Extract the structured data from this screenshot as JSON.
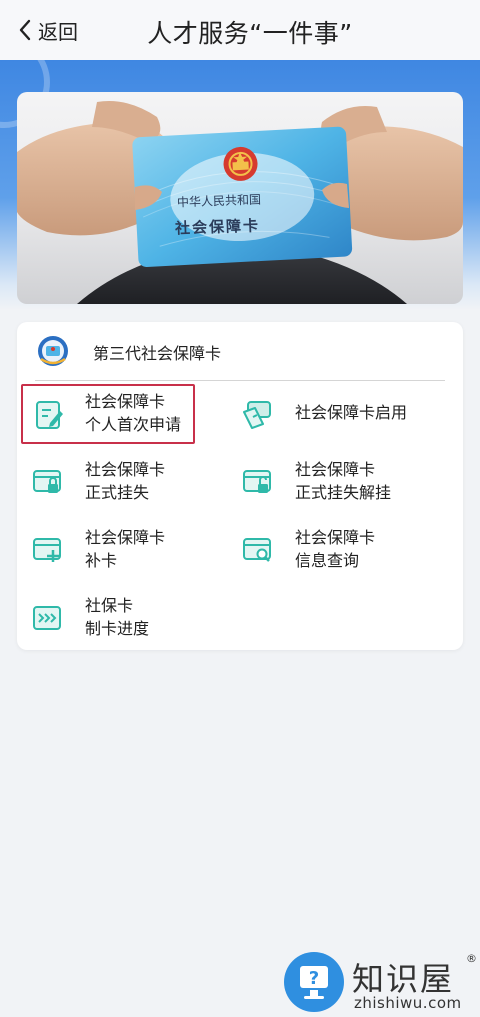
{
  "header": {
    "back_label": "返回",
    "title": "人才服务“一件事”"
  },
  "banner": {
    "card_line1": "中华人民共和国",
    "card_line2": "社会保障卡"
  },
  "service": {
    "title": "第三代社会保障卡",
    "items": [
      {
        "line1": "社会保障卡",
        "line2": "个人首次申请",
        "icon": "edit-document-icon",
        "highlighted": true
      },
      {
        "line1": "社会保障卡启用",
        "line2": "",
        "icon": "card-activate-icon",
        "highlighted": false
      },
      {
        "line1": "社会保障卡",
        "line2": "正式挂失",
        "icon": "card-lock-icon",
        "highlighted": false
      },
      {
        "line1": "社会保障卡",
        "line2": "正式挂失解挂",
        "icon": "card-unlock-icon",
        "highlighted": false
      },
      {
        "line1": "社会保障卡",
        "line2": "补卡",
        "icon": "card-add-icon",
        "highlighted": false
      },
      {
        "line1": "社会保障卡",
        "line2": "信息查询",
        "icon": "card-search-icon",
        "highlighted": false
      },
      {
        "line1": "社保卡",
        "line2": "制卡进度",
        "icon": "card-progress-icon",
        "highlighted": false
      }
    ]
  },
  "watermark": {
    "name": "知识屋",
    "reg": "®",
    "domain": "zhishiwu.com"
  },
  "colors": {
    "accent_teal": "#2fb9a9",
    "accent_blue": "#3f87e2",
    "highlight": "#c8304a"
  }
}
